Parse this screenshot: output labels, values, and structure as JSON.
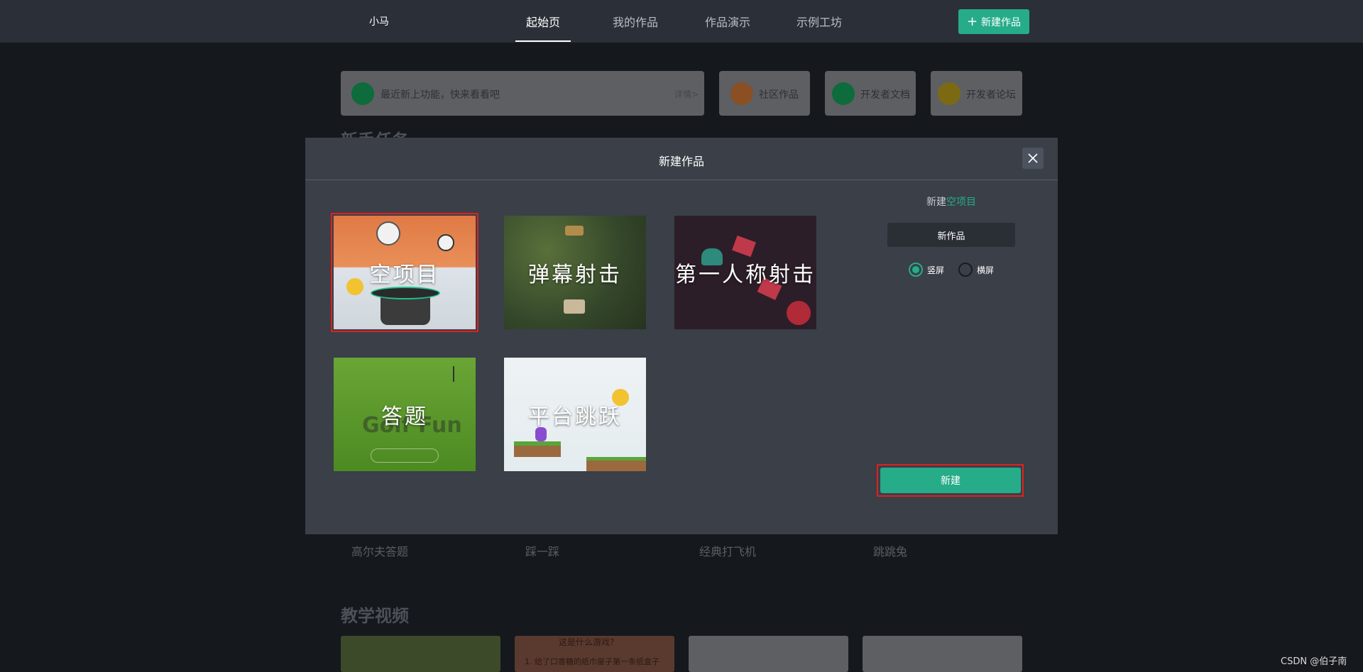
{
  "topnav": {
    "user_name": "小马",
    "tabs": [
      {
        "label": "起始页",
        "active": true
      },
      {
        "label": "我的作品",
        "active": false
      },
      {
        "label": "作品演示",
        "active": false
      },
      {
        "label": "示例工坊",
        "active": false
      }
    ],
    "new_button_label": "新建作品"
  },
  "background": {
    "notice_text": "最近新上功能，快来看看吧",
    "notice_link": "详情>",
    "quick_links": [
      {
        "label": "社区作品",
        "icon": "community-icon"
      },
      {
        "label": "开发者文档",
        "icon": "book-icon"
      },
      {
        "label": "开发者论坛",
        "icon": "forum-icon"
      }
    ],
    "section_partial": "新手任务",
    "game_cards": [
      "高尔夫答题",
      "踩一踩",
      "经典打飞机",
      "跳跳兔"
    ],
    "videos_heading": "教学视频",
    "video_snippet": [
      "这是什么游戏?",
      "1. 给了口香糖的纸巾屋子第一条纸盒子"
    ]
  },
  "modal": {
    "title": "新建作品",
    "templates": [
      {
        "label": "空项目",
        "selected": true,
        "bg": "#e07a45"
      },
      {
        "label": "弹幕射击",
        "selected": false,
        "bg": "#3c4a2a"
      },
      {
        "label": "第一人称射击",
        "selected": false,
        "bg": "#2c1e28"
      },
      {
        "label": "答题",
        "selected": false,
        "bg": "#5a9a2c"
      },
      {
        "label": "平台跳跃",
        "selected": false,
        "bg": "#e8eef2"
      }
    ],
    "side": {
      "new_prefix": "新建",
      "new_type": "空项目",
      "name_value": "新作品",
      "orientation_options": [
        {
          "label": "竖屏",
          "checked": true
        },
        {
          "label": "横屏",
          "checked": false
        }
      ],
      "create_button": "新建"
    }
  },
  "watermark": "CSDN @伯子南",
  "colors": {
    "accent": "#26ac89",
    "highlight": "#e02020",
    "nav_bg": "#2b2f37",
    "modal_bg": "#3a3f48"
  }
}
